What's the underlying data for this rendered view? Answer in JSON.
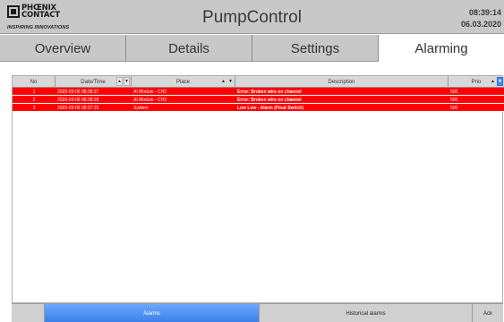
{
  "header": {
    "logo": {
      "line1": "PHŒNIX",
      "line2": "CONTACT",
      "tagline": "INSPIRING INNOVATIONS"
    },
    "title": "PumpControl",
    "time": "08:39:14",
    "date": "06.03.2020"
  },
  "tabs": [
    {
      "label": "Overview"
    },
    {
      "label": "Details"
    },
    {
      "label": "Settings"
    },
    {
      "label": "Alarming",
      "active": true
    }
  ],
  "table": {
    "columns": {
      "no": "No",
      "datetime": "Date/Time",
      "place": "Place",
      "description": "Description",
      "prio": "Prio"
    },
    "sort_up": "▲",
    "sort_down": "▼",
    "rows": [
      {
        "no": "1",
        "datetime": "2020-03-06 08:38:27",
        "place": "AI Module - CH2",
        "description": "Error: Broken wire on channel",
        "prio": "500"
      },
      {
        "no": "2",
        "datetime": "2020-03-06 08:38:28",
        "place": "AI Module - CH3",
        "description": "Error: Broken wire on channel",
        "prio": "500"
      },
      {
        "no": "3",
        "datetime": "2020-03-06 08:37:25",
        "place": "System",
        "description": "Low Low - Alarm (Float Switch)",
        "prio": "500"
      }
    ]
  },
  "bottom": {
    "alarms": "Alarms",
    "historical": "Historical alarms",
    "ack": "Ack"
  },
  "colors": {
    "alarm_row": "#ff0000",
    "active_button": "#3a7fe8",
    "header_bg": "#c8c8c8"
  }
}
